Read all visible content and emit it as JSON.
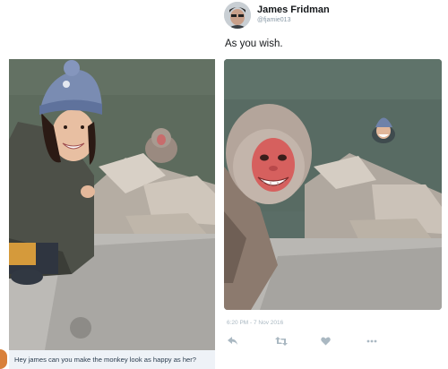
{
  "left": {
    "caption": "Hey james can you make the monkey look as happy as her?"
  },
  "tweet": {
    "display_name": "James Fridman",
    "handle": "@fjamie013",
    "text": "As you wish.",
    "timestamp": "6:20 PM - 7 Nov 2016"
  },
  "actions": {
    "icons": [
      "reply-icon",
      "retweet-icon",
      "like-icon",
      "more-icon"
    ]
  },
  "colors": {
    "name": "#14171a",
    "muted": "#8899a6",
    "icons": "#aab8c2"
  }
}
